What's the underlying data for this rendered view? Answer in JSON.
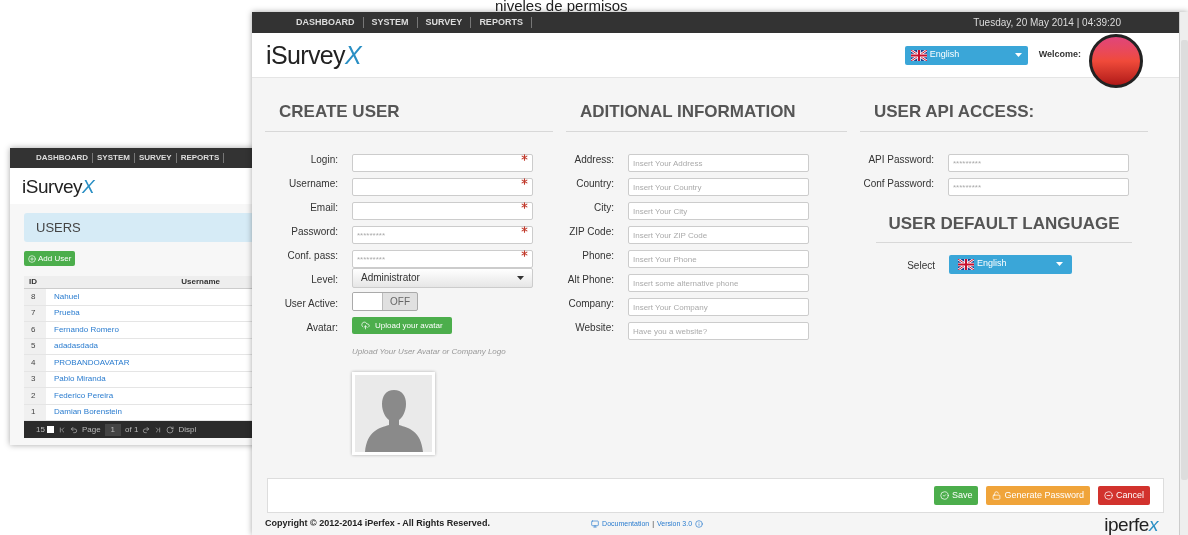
{
  "caption": "niveles de permisos",
  "back_window": {
    "nav": [
      "DASHBOARD",
      "SYSTEM",
      "SURVEY",
      "REPORTS"
    ],
    "logo": {
      "main": "iSurvey",
      "mark": "X"
    },
    "panel_title": "USERS",
    "add_button": "Add User",
    "table": {
      "columns": [
        "ID",
        "Username"
      ],
      "rows": [
        {
          "id": "8",
          "username": "Nahuel"
        },
        {
          "id": "7",
          "username": "Prueba"
        },
        {
          "id": "6",
          "username": "Fernando Romero"
        },
        {
          "id": "5",
          "username": "adadasdada"
        },
        {
          "id": "4",
          "username": "PROBANDOAVATAR"
        },
        {
          "id": "3",
          "username": "Pablo Miranda"
        },
        {
          "id": "2",
          "username": "Federico Pereira"
        },
        {
          "id": "1",
          "username": "Damian Borenstein"
        }
      ]
    },
    "pager": {
      "page_size": "15",
      "page_label": "Page",
      "page": "1",
      "of": "of 1",
      "display": "Displ"
    }
  },
  "front_window": {
    "nav": [
      "DASHBOARD",
      "SYSTEM",
      "SURVEY",
      "REPORTS"
    ],
    "datetime": "Tuesday, 20 May 2014 | 04:39:20",
    "logo": {
      "main": "iSurvey",
      "mark": "X"
    },
    "language": "English",
    "welcome": "Welcome:",
    "create_user": {
      "title": "CREATE USER",
      "fields": [
        {
          "kind": "input",
          "label": "Login:",
          "required": true
        },
        {
          "kind": "input",
          "label": "Username:",
          "required": true
        },
        {
          "kind": "input",
          "label": "Email:",
          "required": true
        },
        {
          "kind": "input",
          "label": "Password:",
          "placeholder": "*********",
          "required": true
        },
        {
          "kind": "input",
          "label": "Conf. pass:",
          "placeholder": "*********",
          "required": true
        },
        {
          "kind": "select",
          "label": "Level:",
          "value": "Administrator"
        },
        {
          "kind": "toggle",
          "label": "User Active:",
          "on": false,
          "text": "OFF"
        },
        {
          "kind": "upload",
          "label": "Avatar:",
          "button": "Upload your avatar",
          "hint": "Upload Your User Avatar or Company Logo"
        }
      ]
    },
    "additional": {
      "title": "ADITIONAL INFORMATION",
      "fields": [
        {
          "label": "Address:",
          "placeholder": "Insert Your Address"
        },
        {
          "label": "Country:",
          "placeholder": "Insert Your Country"
        },
        {
          "label": "City:",
          "placeholder": "Insert Your City"
        },
        {
          "label": "ZIP Code:",
          "placeholder": "Insert Your ZIP Code"
        },
        {
          "label": "Phone:",
          "placeholder": "Insert Your Phone"
        },
        {
          "label": "Alt Phone:",
          "placeholder": "Insert some alternative phone"
        },
        {
          "label": "Company:",
          "placeholder": "Insert Your Company"
        },
        {
          "label": "Website:",
          "placeholder": "Have you a website?"
        }
      ]
    },
    "api": {
      "title": "USER API ACCESS:",
      "fields": [
        {
          "label": "API Password:",
          "placeholder": "*********"
        },
        {
          "label": "Conf Password:",
          "placeholder": "*********"
        }
      ]
    },
    "default_language": {
      "title": "USER DEFAULT LANGUAGE",
      "label": "Select",
      "value": "English"
    },
    "buttons": [
      {
        "kind": "save",
        "label": "Save"
      },
      {
        "kind": "generate",
        "label": "Generate Password"
      },
      {
        "kind": "cancel",
        "label": "Cancel"
      }
    ],
    "footer": {
      "copyright": "Copyright © 2012-2014 iPerfex - All Rights Reserved.",
      "links": [
        "Documentation",
        "Version 3.0"
      ],
      "separator": "|",
      "brand": {
        "main": "iperfe",
        "mark": "x"
      }
    }
  }
}
